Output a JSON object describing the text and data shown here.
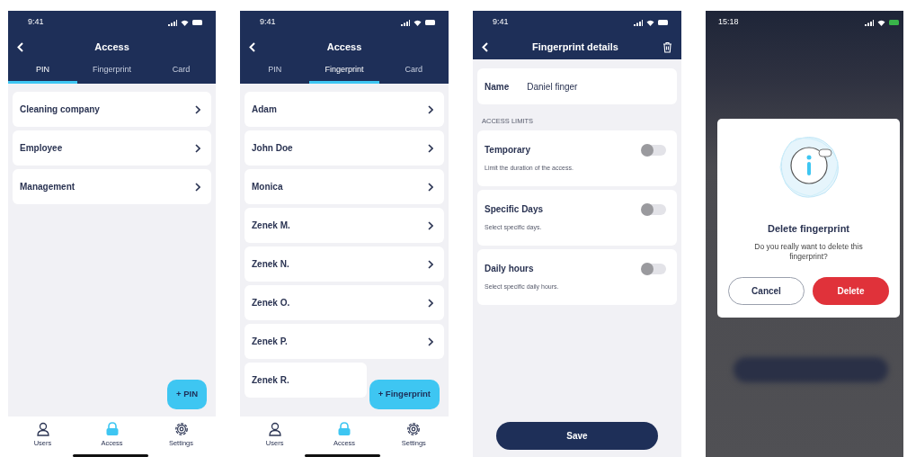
{
  "screens": [
    {
      "kind": "list",
      "status_time": "9:41",
      "title": "Access",
      "tabs": [
        {
          "label": "PIN",
          "selected": true
        },
        {
          "label": "Fingerprint",
          "selected": false
        },
        {
          "label": "Card",
          "selected": false
        }
      ],
      "items": [
        {
          "label": "Cleaning company"
        },
        {
          "label": "Employee"
        },
        {
          "label": "Management"
        }
      ],
      "fab": "+ PIN",
      "tab_bar": [
        {
          "label": "Users",
          "selected": false
        },
        {
          "label": "Access",
          "selected": true
        },
        {
          "label": "Settings",
          "selected": false
        }
      ]
    },
    {
      "kind": "list",
      "status_time": "9:41",
      "title": "Access",
      "tabs": [
        {
          "label": "PIN",
          "selected": false
        },
        {
          "label": "Fingerprint",
          "selected": true
        },
        {
          "label": "Card",
          "selected": false
        }
      ],
      "items": [
        {
          "label": "Adam"
        },
        {
          "label": "John Doe"
        },
        {
          "label": "Monica"
        },
        {
          "label": "Zenek M."
        },
        {
          "label": "Zenek N."
        },
        {
          "label": "Zenek O."
        },
        {
          "label": "Zenek P."
        },
        {
          "label": "Zenek R."
        }
      ],
      "fab": "+ Fingerprint",
      "tab_bar": [
        {
          "label": "Users",
          "selected": false
        },
        {
          "label": "Access",
          "selected": true
        },
        {
          "label": "Settings",
          "selected": false
        }
      ]
    },
    {
      "kind": "details",
      "status_time": "9:41",
      "title": "Fingerprint details",
      "name_label": "Name",
      "name_value": "Daniel finger",
      "section": "ACCESS LIMITS",
      "limits": [
        {
          "title": "Temporary",
          "description": "Limit the duration of the access.",
          "on": false
        },
        {
          "title": "Specific Days",
          "description": "Select specific days.",
          "on": false
        },
        {
          "title": "Daily hours",
          "description": "Select specific daily hours.",
          "on": false
        }
      ],
      "save": "Save"
    },
    {
      "kind": "dialog",
      "status_time": "15:18",
      "dialog": {
        "title": "Delete fingerprint",
        "message": "Do you really want to delete this fingerprint?",
        "buttons": [
          {
            "label": "Cancel",
            "kind": "outline"
          },
          {
            "label": "Delete",
            "kind": "danger"
          }
        ]
      }
    }
  ]
}
